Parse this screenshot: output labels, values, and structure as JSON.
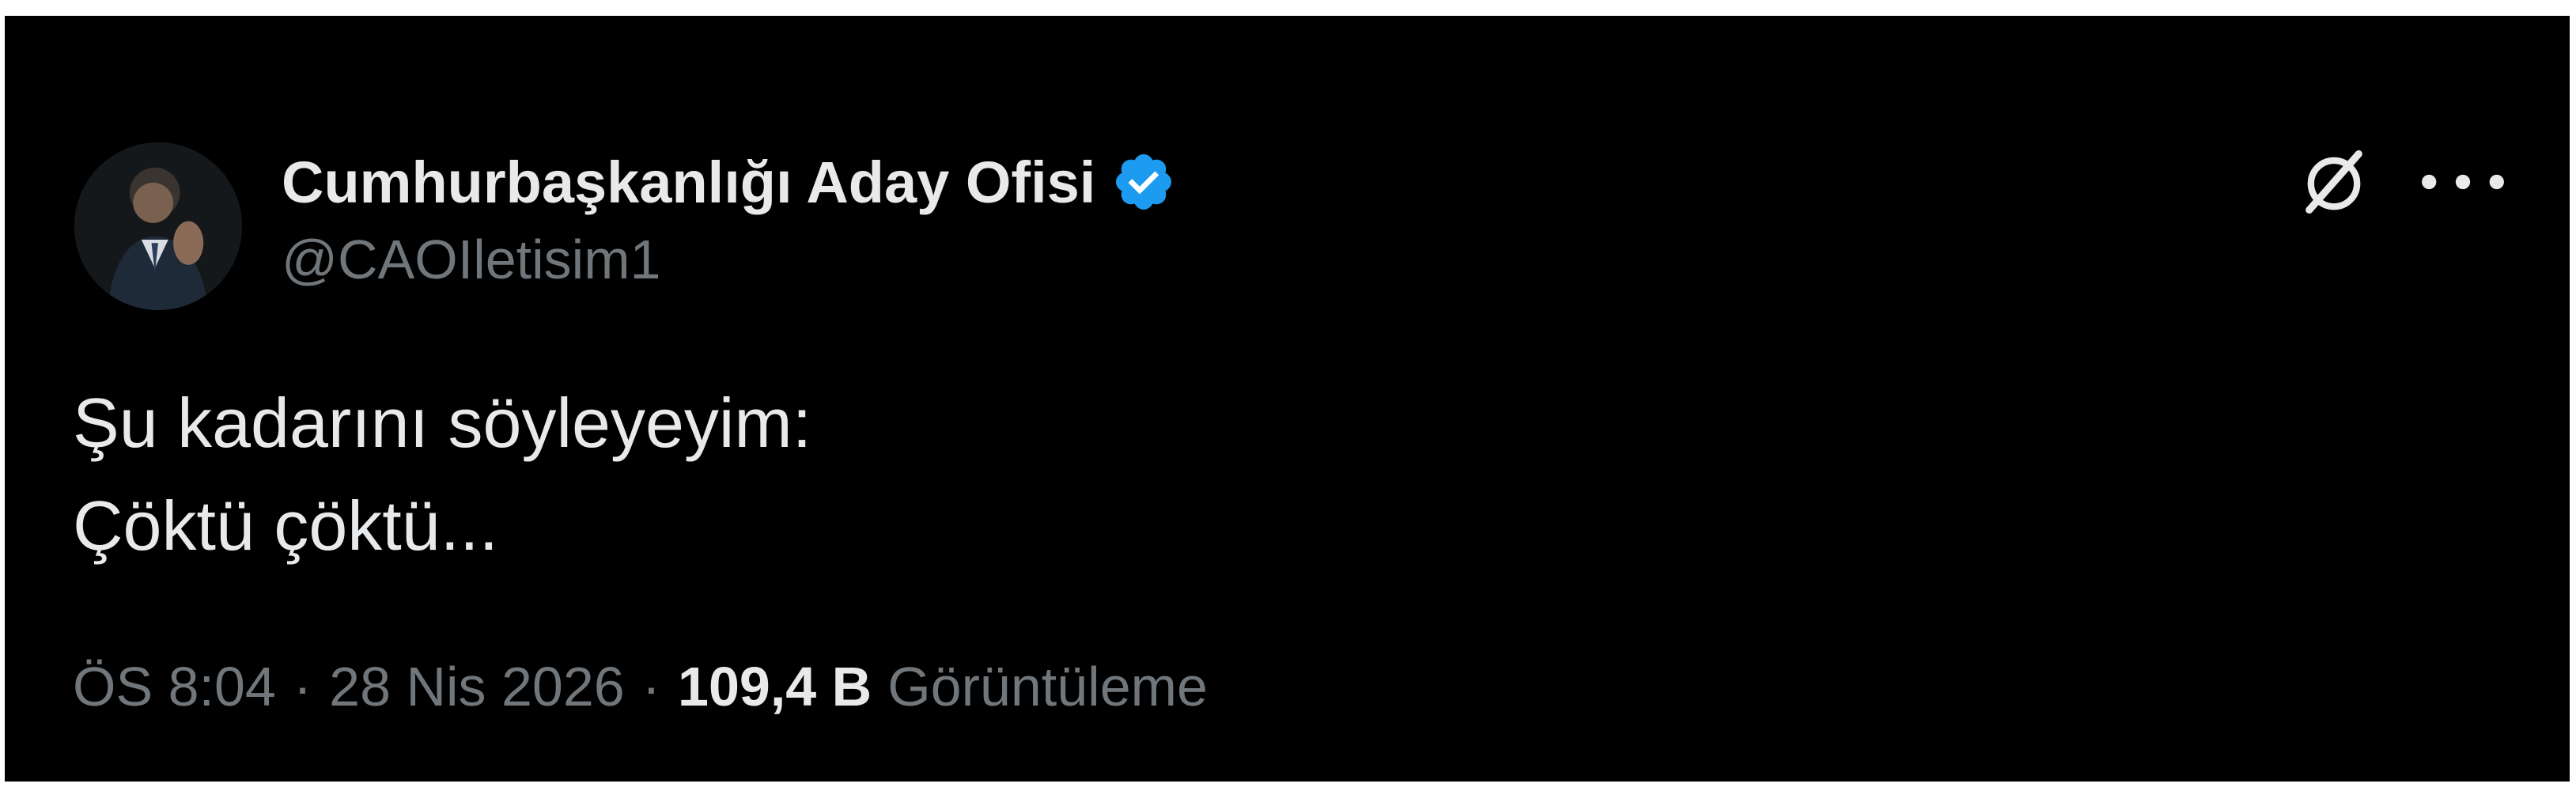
{
  "author": {
    "display_name": "Cumhurbaşkanlığı Aday Ofisi",
    "handle": "@CAOIletisim1",
    "verified": true
  },
  "icons": {
    "avatar": "profile-photo",
    "verified": "verified-badge-icon",
    "grok": "grok-icon",
    "more": "more-options-icon"
  },
  "colors": {
    "background": "#000000",
    "primary_text": "#e7e9ea",
    "secondary_text": "#71767b",
    "verified_blue": "#1d9bf0"
  },
  "tweet": {
    "lines": [
      "Şu kadarını söyleyeyim:",
      "Çöktü çöktü..."
    ]
  },
  "meta": {
    "time": "ÖS 8:04",
    "separator": "·",
    "date": "28 Nis 2026",
    "views_count": "109,4 B",
    "views_label": "Görüntüleme"
  }
}
